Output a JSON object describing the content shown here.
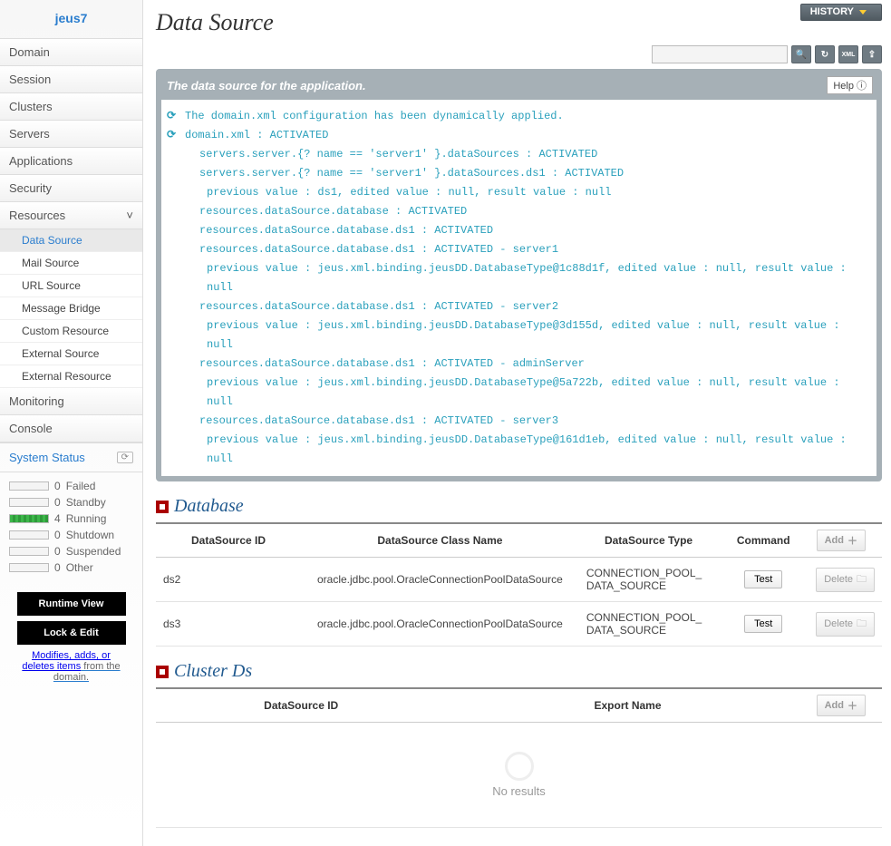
{
  "brand": "jeus7",
  "nav": {
    "domain": "Domain",
    "session": "Session",
    "clusters": "Clusters",
    "servers": "Servers",
    "applications": "Applications",
    "security": "Security",
    "resources": "Resources",
    "monitoring": "Monitoring",
    "console": "Console"
  },
  "resourcesSub": {
    "dataSource": "Data Source",
    "mailSource": "Mail Source",
    "urlSource": "URL Source",
    "messageBridge": "Message Bridge",
    "customResource": "Custom Resource",
    "externalSource": "External Source",
    "externalResource": "External Resource"
  },
  "systemStatus": {
    "title": "System Status",
    "rows": {
      "failed": {
        "count": 0,
        "label": "Failed",
        "filled": false
      },
      "standby": {
        "count": 0,
        "label": "Standby",
        "filled": false
      },
      "running": {
        "count": 4,
        "label": "Running",
        "filled": true
      },
      "shutdown": {
        "count": 0,
        "label": "Shutdown",
        "filled": false
      },
      "suspended": {
        "count": 0,
        "label": "Suspended",
        "filled": false
      },
      "other": {
        "count": 0,
        "label": "Other",
        "filled": false
      }
    }
  },
  "sidebarButtons": {
    "runtimeView": "Runtime View",
    "lockEdit": "Lock & Edit",
    "helperLink": "Modifies, adds, or deletes items",
    "helperSuffix": " from the domain."
  },
  "header": {
    "title": "Data Source",
    "history": "HISTORY"
  },
  "toolbar": {
    "searchIcon": "search-icon",
    "reloadIcon": "reload-icon",
    "xmlIcon": "XML",
    "exportIcon": "export-icon"
  },
  "messagePanel": {
    "title": "The data source for the application.",
    "help": "Help",
    "lines": [
      {
        "refresh": true,
        "indent": 0,
        "text": "The domain.xml configuration has been dynamically applied."
      },
      {
        "refresh": true,
        "indent": 0,
        "text": "domain.xml : ACTIVATED"
      },
      {
        "refresh": false,
        "indent": 1,
        "text": "servers.server.{? name == 'server1' }.dataSources : ACTIVATED"
      },
      {
        "refresh": false,
        "indent": 1,
        "text": "servers.server.{? name == 'server1' }.dataSources.ds1 : ACTIVATED"
      },
      {
        "refresh": false,
        "indent": 2,
        "text": "previous value : ds1, edited value : null, result value : null"
      },
      {
        "refresh": false,
        "indent": 1,
        "text": "resources.dataSource.database : ACTIVATED"
      },
      {
        "refresh": false,
        "indent": 1,
        "text": "resources.dataSource.database.ds1 : ACTIVATED"
      },
      {
        "refresh": false,
        "indent": 1,
        "text": "resources.dataSource.database.ds1 : ACTIVATED - server1"
      },
      {
        "refresh": false,
        "indent": 2,
        "text": "previous value : jeus.xml.binding.jeusDD.DatabaseType@1c88d1f, edited value : null, result value : null"
      },
      {
        "refresh": false,
        "indent": 1,
        "text": "resources.dataSource.database.ds1 : ACTIVATED - server2"
      },
      {
        "refresh": false,
        "indent": 2,
        "text": "previous value : jeus.xml.binding.jeusDD.DatabaseType@3d155d, edited value : null, result value : null"
      },
      {
        "refresh": false,
        "indent": 1,
        "text": "resources.dataSource.database.ds1 : ACTIVATED - adminServer"
      },
      {
        "refresh": false,
        "indent": 2,
        "text": "previous value : jeus.xml.binding.jeusDD.DatabaseType@5a722b, edited value : null, result value : null"
      },
      {
        "refresh": false,
        "indent": 1,
        "text": "resources.dataSource.database.ds1 : ACTIVATED - server3"
      },
      {
        "refresh": false,
        "indent": 2,
        "text": "previous value : jeus.xml.binding.jeusDD.DatabaseType@161d1eb, edited value : null, result value : null"
      }
    ]
  },
  "databaseSection": {
    "title": "Database",
    "columns": {
      "dsid": "DataSource ID",
      "className": "DataSource Class Name",
      "dsType": "DataSource Type",
      "command": "Command",
      "add": "Add"
    },
    "rows": [
      {
        "id": "ds2",
        "className": "oracle.jdbc.pool.OracleConnectionPoolDataSource",
        "type": "CONNECTION_POOL_DATA_SOURCE",
        "cmd": "Test",
        "del": "Delete"
      },
      {
        "id": "ds3",
        "className": "oracle.jdbc.pool.OracleConnectionPoolDataSource",
        "type": "CONNECTION_POOL_DATA_SOURCE",
        "cmd": "Test",
        "del": "Delete"
      }
    ]
  },
  "clusterDsSection": {
    "title": "Cluster Ds",
    "columns": {
      "dsid": "DataSource ID",
      "exportName": "Export Name",
      "add": "Add"
    },
    "noResults": "No results"
  }
}
